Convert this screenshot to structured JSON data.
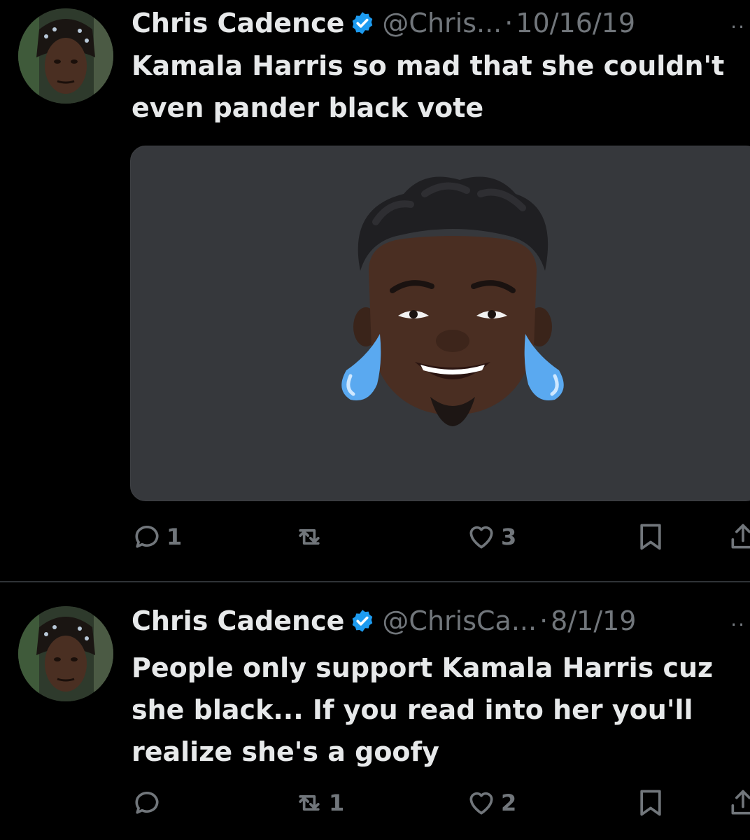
{
  "tweets": [
    {
      "name": "Chris Cadence",
      "handle": "@Chris...",
      "separator": "·",
      "date": "10/16/19",
      "more": "··",
      "text": "Kamala Harris so mad that she couldn't\neven pander black vote",
      "media": "memoji-tears-of-joy",
      "replies": "1",
      "retweets": "",
      "likes": "3"
    },
    {
      "name": "Chris Cadence",
      "handle": "@ChrisCa...",
      "separator": "·",
      "date": "8/1/19",
      "more": "··",
      "text": "People only support Kamala Harris cuz\nshe black... If you read into her you'll\nrealize she's a goofy",
      "replies": "",
      "retweets": "1",
      "likes": "2"
    }
  ],
  "colors": {
    "background": "#000000",
    "text": "#e7e9ea",
    "secondary": "#71767b",
    "verified": "#1d9bf0",
    "media_bg": "#36383c",
    "divider": "#2f3336"
  }
}
